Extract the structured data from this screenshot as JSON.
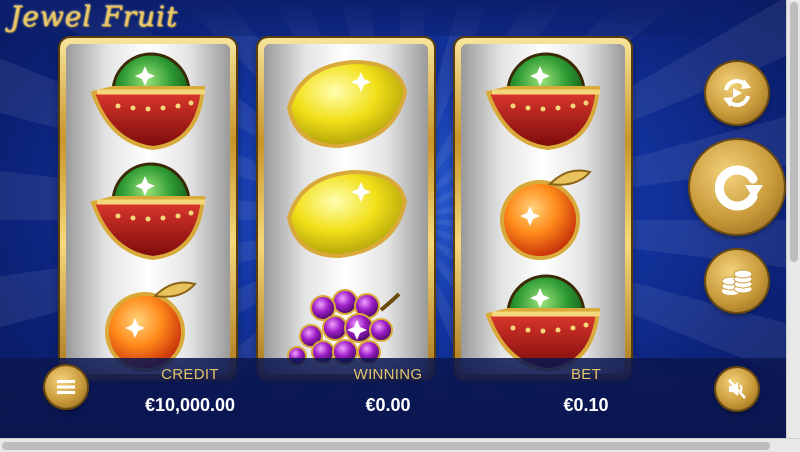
{
  "game": {
    "title": "Jewel Fruit",
    "accent_color": "#d8b25a"
  },
  "reels": [
    {
      "symbols": [
        "watermelon",
        "watermelon",
        "orange"
      ]
    },
    {
      "symbols": [
        "lemon",
        "lemon",
        "grapes"
      ]
    },
    {
      "symbols": [
        "watermelon",
        "orange",
        "watermelon"
      ]
    }
  ],
  "controls": {
    "autoplay_icon": "autoplay-arrows-icon",
    "spin_icon": "spin-arrow-icon",
    "bet_icon": "coins-icon",
    "menu_icon": "hamburger-menu-icon",
    "sound_icon": "sound-muted-icon"
  },
  "stats": {
    "credit_label": "CREDIT",
    "credit_value": "€10,000.00",
    "winning_label": "WINNING",
    "winning_value": "€0.00",
    "bet_label": "BET",
    "bet_value": "€0.10"
  }
}
